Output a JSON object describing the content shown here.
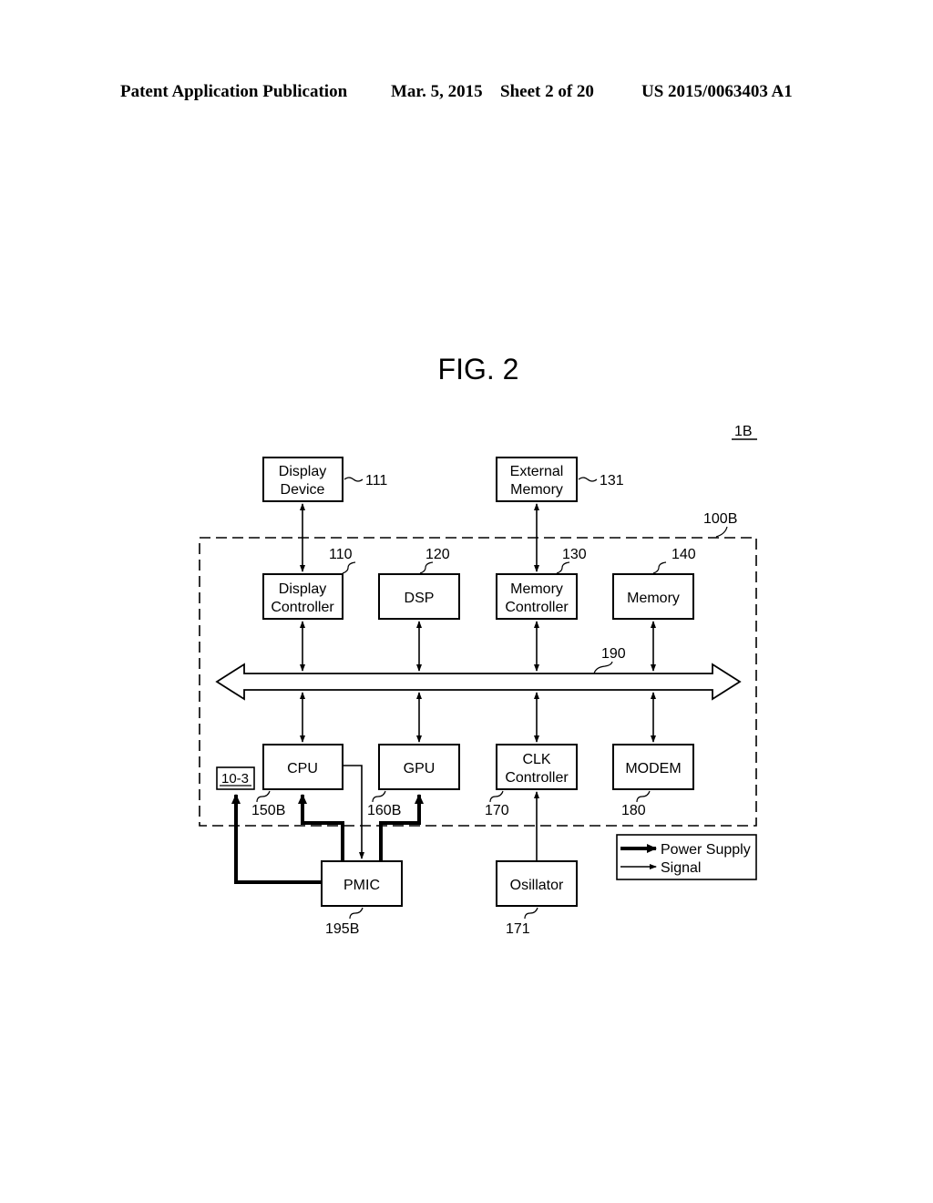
{
  "header": {
    "publication": "Patent Application Publication",
    "date": "Mar. 5, 2015",
    "sheet": "Sheet 2 of 20",
    "number": "US 2015/0063403 A1"
  },
  "figure": {
    "title": "FIG. 2",
    "system_ref": "1B",
    "soc_ref": "100B",
    "bus_ref": "190"
  },
  "blocks": {
    "display_device": {
      "line1": "Display",
      "line2": "Device",
      "ref": "111"
    },
    "external_memory": {
      "line1": "External",
      "line2": "Memory",
      "ref": "131"
    },
    "display_controller": {
      "line1": "Display",
      "line2": "Controller",
      "ref": "110"
    },
    "dsp": {
      "line1": "DSP",
      "ref": "120"
    },
    "memory_controller": {
      "line1": "Memory",
      "line2": "Controller",
      "ref": "130"
    },
    "memory": {
      "line1": "Memory",
      "ref": "140"
    },
    "cpu": {
      "line1": "CPU",
      "ref": "150B"
    },
    "gpu": {
      "line1": "GPU",
      "ref": "160B"
    },
    "clk_controller": {
      "line1": "CLK",
      "line2": "Controller",
      "ref": "170"
    },
    "modem": {
      "line1": "MODEM",
      "ref": "180"
    },
    "battery": {
      "line1": "10-3"
    },
    "pmic": {
      "line1": "PMIC",
      "ref": "195B"
    },
    "oscillator": {
      "line1": "Osillator",
      "ref": "171"
    }
  },
  "legend": {
    "power": "Power Supply",
    "signal": "Signal"
  }
}
